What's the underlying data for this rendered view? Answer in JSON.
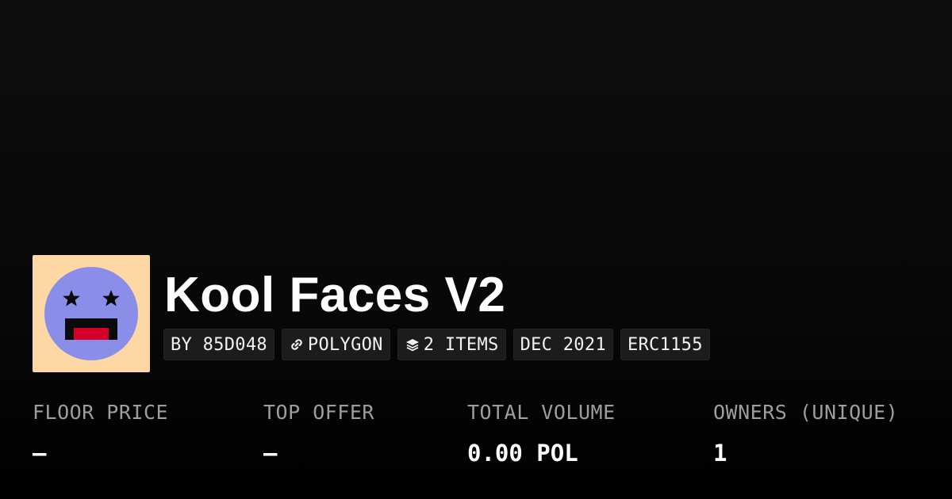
{
  "collection": {
    "title": "Kool Faces V2",
    "avatar_icon": "smiley-face-icon",
    "chips": [
      {
        "label": "BY 85D048",
        "icon": null
      },
      {
        "label": "POLYGON",
        "icon": "link-icon"
      },
      {
        "label": "2 ITEMS",
        "icon": "layers-icon"
      },
      {
        "label": "DEC 2021",
        "icon": null
      },
      {
        "label": "ERC1155",
        "icon": null
      }
    ]
  },
  "stats": [
    {
      "label": "FLOOR PRICE",
      "value": "–"
    },
    {
      "label": "TOP OFFER",
      "value": "–"
    },
    {
      "label": "TOTAL VOLUME",
      "value": "0.00 POL"
    },
    {
      "label": "OWNERS (UNIQUE)",
      "value": "1"
    }
  ],
  "colors": {
    "background": "#0b0b0b",
    "avatar_bg": "#fdd7a4",
    "avatar_face": "#8a8ee9",
    "mouth_red": "#d4002a",
    "chip_bg": "#1c1c1c",
    "label_gray": "#9e9e9e"
  }
}
